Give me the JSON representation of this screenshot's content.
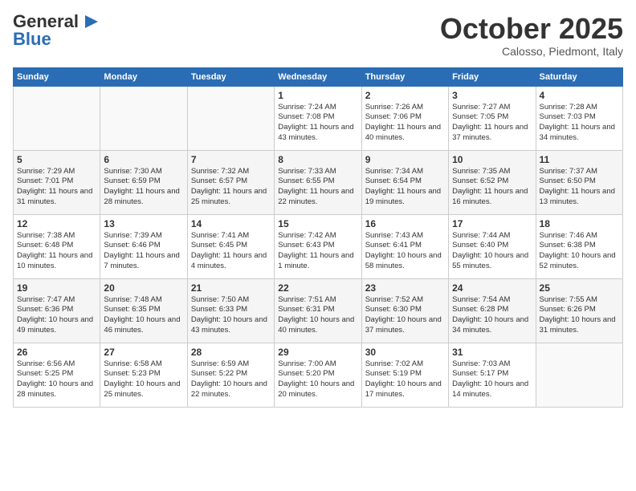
{
  "header": {
    "logo_general": "General",
    "logo_blue": "Blue",
    "month": "October 2025",
    "location": "Calosso, Piedmont, Italy"
  },
  "days_of_week": [
    "Sunday",
    "Monday",
    "Tuesday",
    "Wednesday",
    "Thursday",
    "Friday",
    "Saturday"
  ],
  "weeks": [
    [
      {
        "day": "",
        "sunrise": "",
        "sunset": "",
        "daylight": ""
      },
      {
        "day": "",
        "sunrise": "",
        "sunset": "",
        "daylight": ""
      },
      {
        "day": "",
        "sunrise": "",
        "sunset": "",
        "daylight": ""
      },
      {
        "day": "1",
        "sunrise": "Sunrise: 7:24 AM",
        "sunset": "Sunset: 7:08 PM",
        "daylight": "Daylight: 11 hours and 43 minutes."
      },
      {
        "day": "2",
        "sunrise": "Sunrise: 7:26 AM",
        "sunset": "Sunset: 7:06 PM",
        "daylight": "Daylight: 11 hours and 40 minutes."
      },
      {
        "day": "3",
        "sunrise": "Sunrise: 7:27 AM",
        "sunset": "Sunset: 7:05 PM",
        "daylight": "Daylight: 11 hours and 37 minutes."
      },
      {
        "day": "4",
        "sunrise": "Sunrise: 7:28 AM",
        "sunset": "Sunset: 7:03 PM",
        "daylight": "Daylight: 11 hours and 34 minutes."
      }
    ],
    [
      {
        "day": "5",
        "sunrise": "Sunrise: 7:29 AM",
        "sunset": "Sunset: 7:01 PM",
        "daylight": "Daylight: 11 hours and 31 minutes."
      },
      {
        "day": "6",
        "sunrise": "Sunrise: 7:30 AM",
        "sunset": "Sunset: 6:59 PM",
        "daylight": "Daylight: 11 hours and 28 minutes."
      },
      {
        "day": "7",
        "sunrise": "Sunrise: 7:32 AM",
        "sunset": "Sunset: 6:57 PM",
        "daylight": "Daylight: 11 hours and 25 minutes."
      },
      {
        "day": "8",
        "sunrise": "Sunrise: 7:33 AM",
        "sunset": "Sunset: 6:55 PM",
        "daylight": "Daylight: 11 hours and 22 minutes."
      },
      {
        "day": "9",
        "sunrise": "Sunrise: 7:34 AM",
        "sunset": "Sunset: 6:54 PM",
        "daylight": "Daylight: 11 hours and 19 minutes."
      },
      {
        "day": "10",
        "sunrise": "Sunrise: 7:35 AM",
        "sunset": "Sunset: 6:52 PM",
        "daylight": "Daylight: 11 hours and 16 minutes."
      },
      {
        "day": "11",
        "sunrise": "Sunrise: 7:37 AM",
        "sunset": "Sunset: 6:50 PM",
        "daylight": "Daylight: 11 hours and 13 minutes."
      }
    ],
    [
      {
        "day": "12",
        "sunrise": "Sunrise: 7:38 AM",
        "sunset": "Sunset: 6:48 PM",
        "daylight": "Daylight: 11 hours and 10 minutes."
      },
      {
        "day": "13",
        "sunrise": "Sunrise: 7:39 AM",
        "sunset": "Sunset: 6:46 PM",
        "daylight": "Daylight: 11 hours and 7 minutes."
      },
      {
        "day": "14",
        "sunrise": "Sunrise: 7:41 AM",
        "sunset": "Sunset: 6:45 PM",
        "daylight": "Daylight: 11 hours and 4 minutes."
      },
      {
        "day": "15",
        "sunrise": "Sunrise: 7:42 AM",
        "sunset": "Sunset: 6:43 PM",
        "daylight": "Daylight: 11 hours and 1 minute."
      },
      {
        "day": "16",
        "sunrise": "Sunrise: 7:43 AM",
        "sunset": "Sunset: 6:41 PM",
        "daylight": "Daylight: 10 hours and 58 minutes."
      },
      {
        "day": "17",
        "sunrise": "Sunrise: 7:44 AM",
        "sunset": "Sunset: 6:40 PM",
        "daylight": "Daylight: 10 hours and 55 minutes."
      },
      {
        "day": "18",
        "sunrise": "Sunrise: 7:46 AM",
        "sunset": "Sunset: 6:38 PM",
        "daylight": "Daylight: 10 hours and 52 minutes."
      }
    ],
    [
      {
        "day": "19",
        "sunrise": "Sunrise: 7:47 AM",
        "sunset": "Sunset: 6:36 PM",
        "daylight": "Daylight: 10 hours and 49 minutes."
      },
      {
        "day": "20",
        "sunrise": "Sunrise: 7:48 AM",
        "sunset": "Sunset: 6:35 PM",
        "daylight": "Daylight: 10 hours and 46 minutes."
      },
      {
        "day": "21",
        "sunrise": "Sunrise: 7:50 AM",
        "sunset": "Sunset: 6:33 PM",
        "daylight": "Daylight: 10 hours and 43 minutes."
      },
      {
        "day": "22",
        "sunrise": "Sunrise: 7:51 AM",
        "sunset": "Sunset: 6:31 PM",
        "daylight": "Daylight: 10 hours and 40 minutes."
      },
      {
        "day": "23",
        "sunrise": "Sunrise: 7:52 AM",
        "sunset": "Sunset: 6:30 PM",
        "daylight": "Daylight: 10 hours and 37 minutes."
      },
      {
        "day": "24",
        "sunrise": "Sunrise: 7:54 AM",
        "sunset": "Sunset: 6:28 PM",
        "daylight": "Daylight: 10 hours and 34 minutes."
      },
      {
        "day": "25",
        "sunrise": "Sunrise: 7:55 AM",
        "sunset": "Sunset: 6:26 PM",
        "daylight": "Daylight: 10 hours and 31 minutes."
      }
    ],
    [
      {
        "day": "26",
        "sunrise": "Sunrise: 6:56 AM",
        "sunset": "Sunset: 5:25 PM",
        "daylight": "Daylight: 10 hours and 28 minutes."
      },
      {
        "day": "27",
        "sunrise": "Sunrise: 6:58 AM",
        "sunset": "Sunset: 5:23 PM",
        "daylight": "Daylight: 10 hours and 25 minutes."
      },
      {
        "day": "28",
        "sunrise": "Sunrise: 6:59 AM",
        "sunset": "Sunset: 5:22 PM",
        "daylight": "Daylight: 10 hours and 22 minutes."
      },
      {
        "day": "29",
        "sunrise": "Sunrise: 7:00 AM",
        "sunset": "Sunset: 5:20 PM",
        "daylight": "Daylight: 10 hours and 20 minutes."
      },
      {
        "day": "30",
        "sunrise": "Sunrise: 7:02 AM",
        "sunset": "Sunset: 5:19 PM",
        "daylight": "Daylight: 10 hours and 17 minutes."
      },
      {
        "day": "31",
        "sunrise": "Sunrise: 7:03 AM",
        "sunset": "Sunset: 5:17 PM",
        "daylight": "Daylight: 10 hours and 14 minutes."
      },
      {
        "day": "",
        "sunrise": "",
        "sunset": "",
        "daylight": ""
      }
    ]
  ]
}
